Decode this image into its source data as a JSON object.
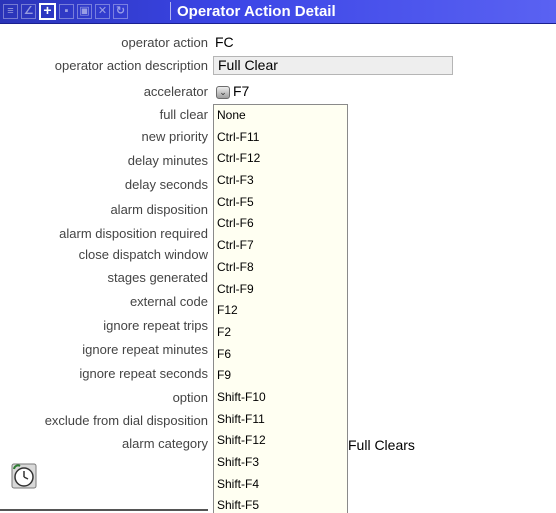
{
  "window": {
    "title": "Operator Action Detail",
    "toolbar_icons": [
      "list-icon",
      "edit-icon",
      "add-icon",
      "save-icon",
      "print-icon",
      "delete-icon",
      "refresh-icon"
    ]
  },
  "form": {
    "operator_action": {
      "label": "operator action",
      "value": "FC"
    },
    "operator_action_description": {
      "label": "operator action description",
      "value": "Full Clear"
    },
    "accelerator": {
      "label": "accelerator",
      "value": "F7"
    },
    "full_clear": {
      "label": "full clear"
    },
    "new_priority": {
      "label": "new priority"
    },
    "delay_minutes": {
      "label": "delay minutes"
    },
    "delay_seconds": {
      "label": "delay seconds"
    },
    "alarm_disposition": {
      "label": "alarm disposition"
    },
    "alarm_disposition_required": {
      "label": "alarm disposition required"
    },
    "close_dispatch_window": {
      "label": "close dispatch window"
    },
    "stages_generated": {
      "label": "stages generated"
    },
    "external_code": {
      "label": "external code"
    },
    "ignore_repeat_trips": {
      "label": "ignore repeat trips"
    },
    "ignore_repeat_minutes": {
      "label": "ignore repeat minutes"
    },
    "ignore_repeat_seconds": {
      "label": "ignore repeat seconds"
    },
    "option": {
      "label": "option"
    },
    "exclude_from_dial_disposition": {
      "label": "exclude from dial disposition"
    },
    "alarm_category": {
      "label": "alarm category",
      "value": "Full Clears"
    }
  },
  "accelerator_dropdown": {
    "options": [
      "None",
      "Ctrl-F11",
      "Ctrl-F12",
      "Ctrl-F3",
      "Ctrl-F5",
      "Ctrl-F6",
      "Ctrl-F7",
      "Ctrl-F8",
      "Ctrl-F9",
      "F12",
      "F2",
      "F6",
      "F9",
      "Shift-F10",
      "Shift-F11",
      "Shift-F12",
      "Shift-F3",
      "Shift-F4",
      "Shift-F5"
    ]
  },
  "colors": {
    "titlebar": "#3b45e6",
    "dropdown_bg": "#fffff2",
    "field_bg": "#eeeeee"
  }
}
